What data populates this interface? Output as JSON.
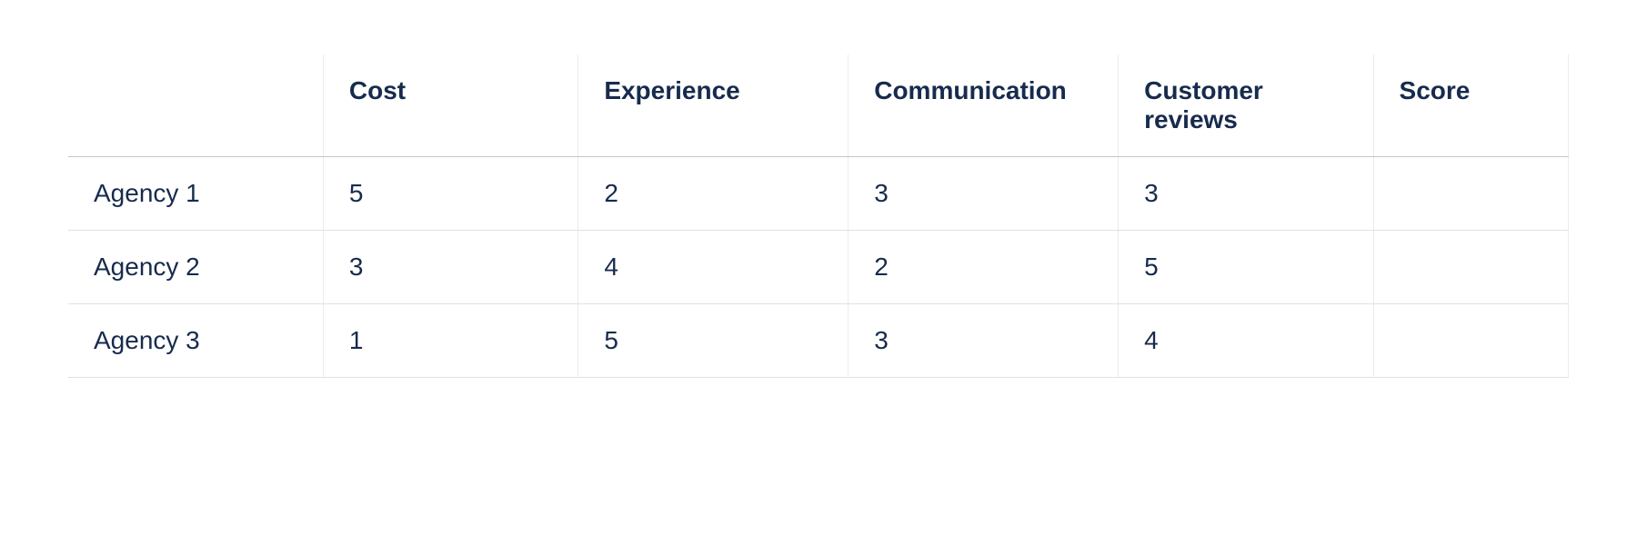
{
  "chart_data": {
    "type": "table",
    "columns": [
      "",
      "Cost",
      "Experience",
      "Communication",
      "Customer reviews",
      "Score"
    ],
    "rows": [
      {
        "label": "Agency 1",
        "values": [
          "5",
          "2",
          "3",
          "3",
          ""
        ]
      },
      {
        "label": "Agency 2",
        "values": [
          "3",
          "4",
          "2",
          "5",
          ""
        ]
      },
      {
        "label": "Agency 3",
        "values": [
          "1",
          "5",
          "3",
          "4",
          ""
        ]
      }
    ]
  }
}
